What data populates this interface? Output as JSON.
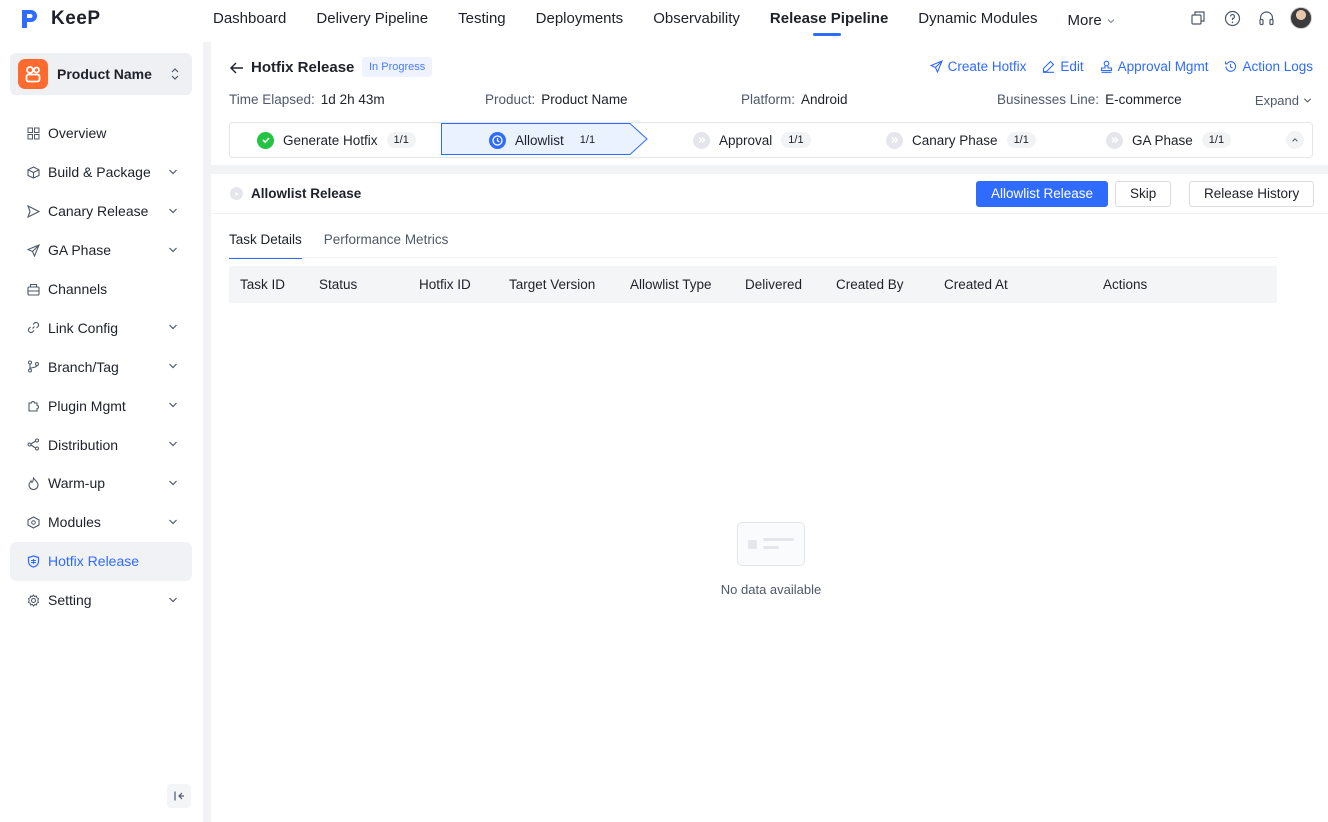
{
  "app": {
    "name": "KeeP"
  },
  "nav": {
    "items": [
      "Dashboard",
      "Delivery Pipeline",
      "Testing",
      "Deployments",
      "Observability",
      "Release Pipeline",
      "Dynamic Modules"
    ],
    "active": "Release Pipeline",
    "more_label": "More"
  },
  "top_icons": [
    "copy-icon",
    "help-icon",
    "headset-icon",
    "user-avatar"
  ],
  "sidebar": {
    "product_name": "Product Name",
    "items": [
      {
        "label": "Overview",
        "icon": "grid-icon",
        "has_children": false
      },
      {
        "label": "Build & Package",
        "icon": "package-icon",
        "has_children": true
      },
      {
        "label": "Canary Release",
        "icon": "send-icon",
        "has_children": true
      },
      {
        "label": "GA Phase",
        "icon": "plane-icon",
        "has_children": true
      },
      {
        "label": "Channels",
        "icon": "channels-icon",
        "has_children": false
      },
      {
        "label": "Link Config",
        "icon": "link-icon",
        "has_children": true
      },
      {
        "label": "Branch/Tag",
        "icon": "branch-icon",
        "has_children": true
      },
      {
        "label": "Plugin Mgmt",
        "icon": "puzzle-icon",
        "has_children": true
      },
      {
        "label": "Distribution",
        "icon": "distribution-icon",
        "has_children": true
      },
      {
        "label": "Warm-up",
        "icon": "flame-icon",
        "has_children": true
      },
      {
        "label": "Modules",
        "icon": "cube-icon",
        "has_children": true
      },
      {
        "label": "Hotfix Release",
        "icon": "shield-icon",
        "has_children": false,
        "active": true
      },
      {
        "label": "Setting",
        "icon": "gear-icon",
        "has_children": true
      }
    ]
  },
  "header": {
    "title": "Hotfix Release",
    "status": "In Progress",
    "actions": [
      {
        "label": "Create Hotfix",
        "icon": "send-icon"
      },
      {
        "label": "Edit",
        "icon": "edit-icon"
      },
      {
        "label": "Approval Mgmt",
        "icon": "stamp-icon"
      },
      {
        "label": "Action Logs",
        "icon": "history-icon"
      }
    ],
    "meta": [
      {
        "key": "Time Elapsed:",
        "value": "1d 2h 43m"
      },
      {
        "key": "Product:",
        "value": "Product Name"
      },
      {
        "key": "Platform:",
        "value": "Android"
      },
      {
        "key": "Businesses Line:",
        "value": "E-commerce"
      }
    ],
    "expand_label": "Expand",
    "steps": [
      {
        "label": "Generate Hotfix",
        "count": "1/1",
        "state": "done"
      },
      {
        "label": "Allowlist",
        "count": "1/1",
        "state": "active"
      },
      {
        "label": "Approval",
        "count": "1/1",
        "state": "pending"
      },
      {
        "label": "Canary Phase",
        "count": "1/1",
        "state": "pending"
      },
      {
        "label": "GA Phase",
        "count": "1/1",
        "state": "pending"
      }
    ]
  },
  "section": {
    "title": "Allowlist Release",
    "buttons": {
      "primary": "Allowlist Release",
      "skip": "Skip",
      "history": "Release History"
    },
    "tabs": [
      "Task Details",
      "Performance Metrics"
    ],
    "active_tab": "Task Details",
    "columns": [
      "Task ID",
      "Status",
      "Hotfix ID",
      "Target Version",
      "Allowlist Type",
      "Delivered",
      "Created By",
      "Created At",
      "Actions"
    ],
    "rows": [],
    "empty_text": "No data available"
  },
  "colors": {
    "primary": "#2f6bff",
    "success": "#23c343",
    "brand_orange": "#ff6a2f"
  }
}
